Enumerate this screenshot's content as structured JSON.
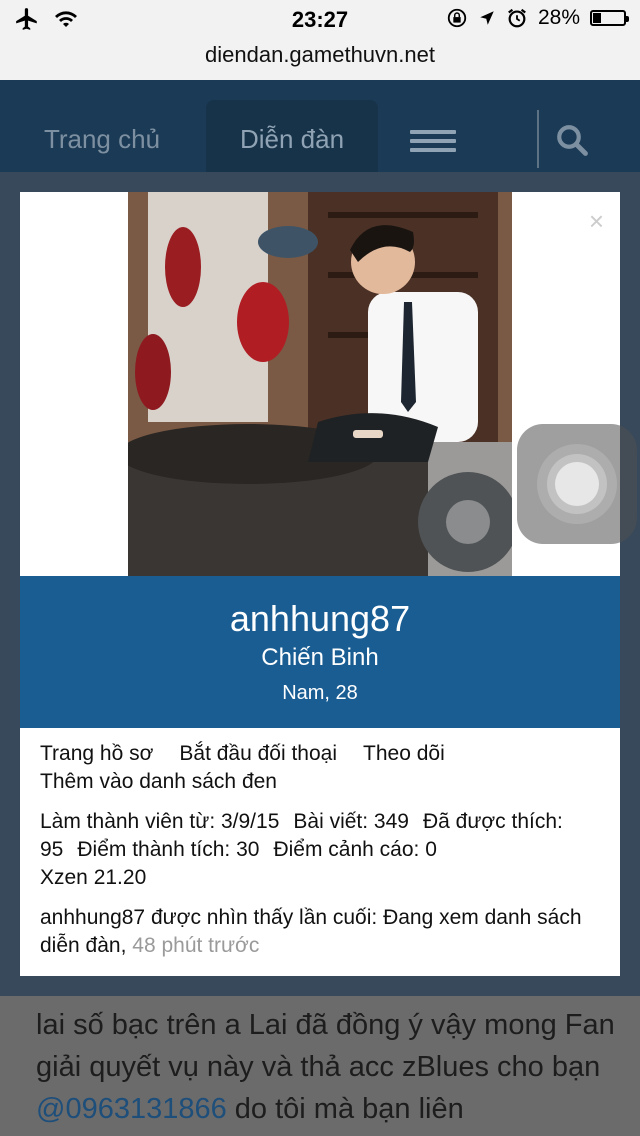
{
  "status_bar": {
    "time": "23:27",
    "battery": "28%",
    "battery_level": 0.28
  },
  "browser": {
    "url": "diendan.gamethuvn.net"
  },
  "nav": {
    "home": "Trang chủ",
    "forum": "Diễn đàn"
  },
  "profile": {
    "username": "anhhung87",
    "rank": "Chiến Binh",
    "info": "Nam, 28",
    "links": [
      "Trang hồ sơ",
      "Bắt đầu đối thoại",
      "Theo dõi",
      "Thêm vào danh sách đen"
    ],
    "stats": {
      "joined": "Làm thành viên từ: 3/9/15",
      "posts": "Bài viết: 349",
      "liked": "Đã được thích: 95",
      "points": "Điểm thành tích: 30",
      "warnings": "Điểm cảnh cáo: 0",
      "xzen": "Xzen 21.20"
    },
    "last_seen": "anhhung87 được nhìn thấy lần cuối: Đang xem danh sách diễn đàn,",
    "last_seen_time": "48 phút trước"
  },
  "background_post": {
    "text_1": "lai số bạc trên a Lai đã đồng ý vậy mong Fan giải quyết vụ này và thả acc zBlues cho bạn",
    "mention": "@0963131866",
    "text_2": "do tôi mà bạn liên"
  },
  "colors": {
    "nav_bg": "#1b3a55",
    "name_bar": "#195d93",
    "mention": "#1e4e7a"
  }
}
